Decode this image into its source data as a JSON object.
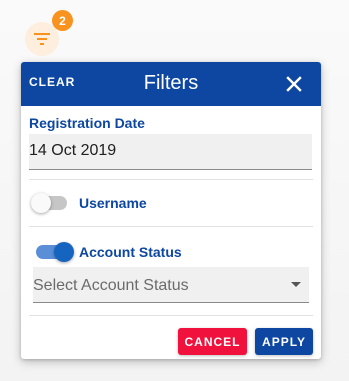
{
  "filter_button": {
    "icon": "filter-icon",
    "badge_count": "2",
    "badge_color": "#f7931e"
  },
  "panel": {
    "header_color": "#0d47a1",
    "clear_label": "CLEAR",
    "title": "Filters",
    "close_icon": "close-icon"
  },
  "registration_date": {
    "label": "Registration Date",
    "value": "14 Oct 2019"
  },
  "username_toggle": {
    "label": "Username",
    "checked": false
  },
  "account_status": {
    "label": "Account Status",
    "checked": true,
    "select_placeholder": "Select Account Status"
  },
  "actions": {
    "cancel_label": "CANCEL",
    "cancel_color": "#f0123c",
    "apply_label": "APPLY",
    "apply_color": "#0d47a1"
  }
}
